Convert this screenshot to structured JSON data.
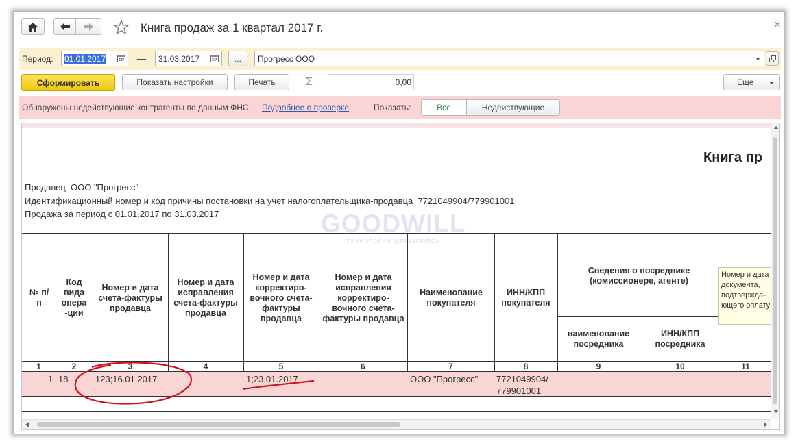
{
  "window": {
    "title": "Книга продаж за 1 квартал 2017 г.",
    "close_glyph": "×"
  },
  "filters": {
    "period_label": "Период:",
    "period_from": "01.01.2017",
    "dash": "—",
    "period_to": "31.03.2017",
    "more_button": "...",
    "organization": "Прогресс ООО"
  },
  "toolbar": {
    "generate": "Сформировать",
    "show_settings": "Показать настройки",
    "print": "Печать",
    "sigma": "Σ",
    "sum_value": "0,00",
    "more": "Еще"
  },
  "warning": {
    "message": "Обнаружены недействующие контрагенты по данным ФНС",
    "link": "Подробнее о проверке",
    "show_label": "Показать:",
    "btn_all": "Все",
    "btn_inactive": "Недействующие"
  },
  "report": {
    "title": "Книга пр",
    "seller_line": "Продавец  ООО \"Прогресс\"",
    "inn_line": "Идентификационный номер и код причины постановки на учет налогоплательщика-продавца  7721049904/779901001",
    "period_line": "Продажа за период с 01.01.2017 по 31.03.2017",
    "watermark": "GOODWILL",
    "watermark_sub": "ТЕХНОЛОГИИ ДЛЯ БИЗНЕСА",
    "tooltip": "Номер и дата документа, подтвержда-ющего оплату",
    "columns": [
      "№ п/п",
      "Код вида опера -ции",
      "Номер и дата счета-фактуры продавца",
      "Номер и дата исправления счета-фактуры продавца",
      "Номер и дата корректиро-вочного счета-фактуры продавца",
      "Номер и дата исправления корректиро-вочного счета-фактуры продавца",
      "Наименование покупателя",
      "ИНН/КПП покупателя"
    ],
    "intermediary_header": "Сведения о посреднике (комиссионере, агенте)",
    "intermediary_sub": [
      "наименование посредника",
      "ИНН/КПП посредника"
    ],
    "col_numbers": [
      "1",
      "2",
      "3",
      "4",
      "5",
      "6",
      "7",
      "8",
      "9",
      "10",
      "11"
    ],
    "row": {
      "n": "1",
      "code": "18",
      "invoice": "123;16.01.2017",
      "corr_invoice": "1;23.01.2017",
      "buyer": "ООО \"Прогресс\"",
      "buyer_inn1": "7721049904/",
      "buyer_inn2": "779901001"
    }
  },
  "colors": {
    "generate_btn": "#f5d21f",
    "warning_bg": "#f9d5d5",
    "link": "#2a5ab0",
    "annotation": "#d0141e"
  }
}
